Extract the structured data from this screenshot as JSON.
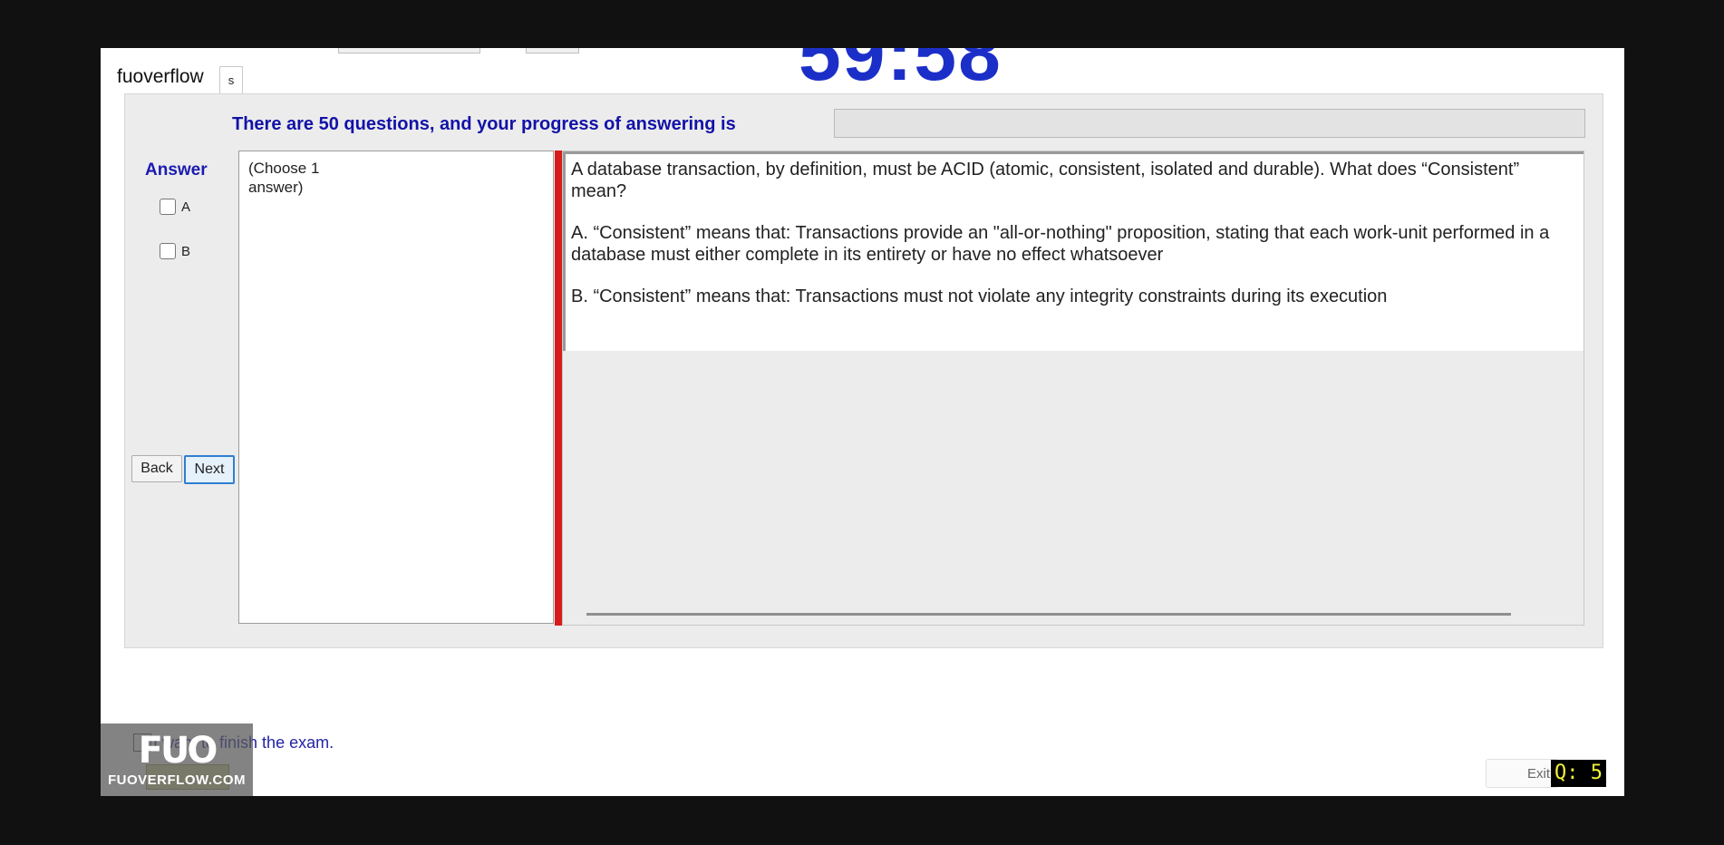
{
  "app": {
    "title": "fuoverflow",
    "tab_label": "s",
    "timer": "59:58"
  },
  "progress": {
    "label": "There are 50 questions, and your progress of answering is",
    "value": 0
  },
  "answer": {
    "label": "Answer",
    "options": [
      "A",
      "B"
    ],
    "choose_hint": "(Choose 1\nanswer)"
  },
  "nav": {
    "back_label": "Back",
    "next_label": "Next"
  },
  "question": {
    "stem": "A database transaction, by definition, must be ACID (atomic, consistent, isolated and durable). What does “Consistent” mean?",
    "option_a": "A.  “Consistent” means that: Transactions provide an \"all-or-nothing\" proposition, stating that each work-unit performed in a database must either complete in its entirety or have no effect whatsoever",
    "option_b": "B.  “Consistent” means that: Transactions must not violate any integrity constraints during its execution"
  },
  "finish": {
    "text": "I want to finish the exam."
  },
  "watermark": {
    "mark": "FUO",
    "site": "FUOVERFLOW.COM"
  },
  "exit": {
    "label": "Exit"
  },
  "badge": {
    "label": "Q: 5"
  },
  "colors": {
    "timer": "#1b2fc8",
    "label_blue": "#1212a8",
    "divider_red": "#d81c1c"
  }
}
